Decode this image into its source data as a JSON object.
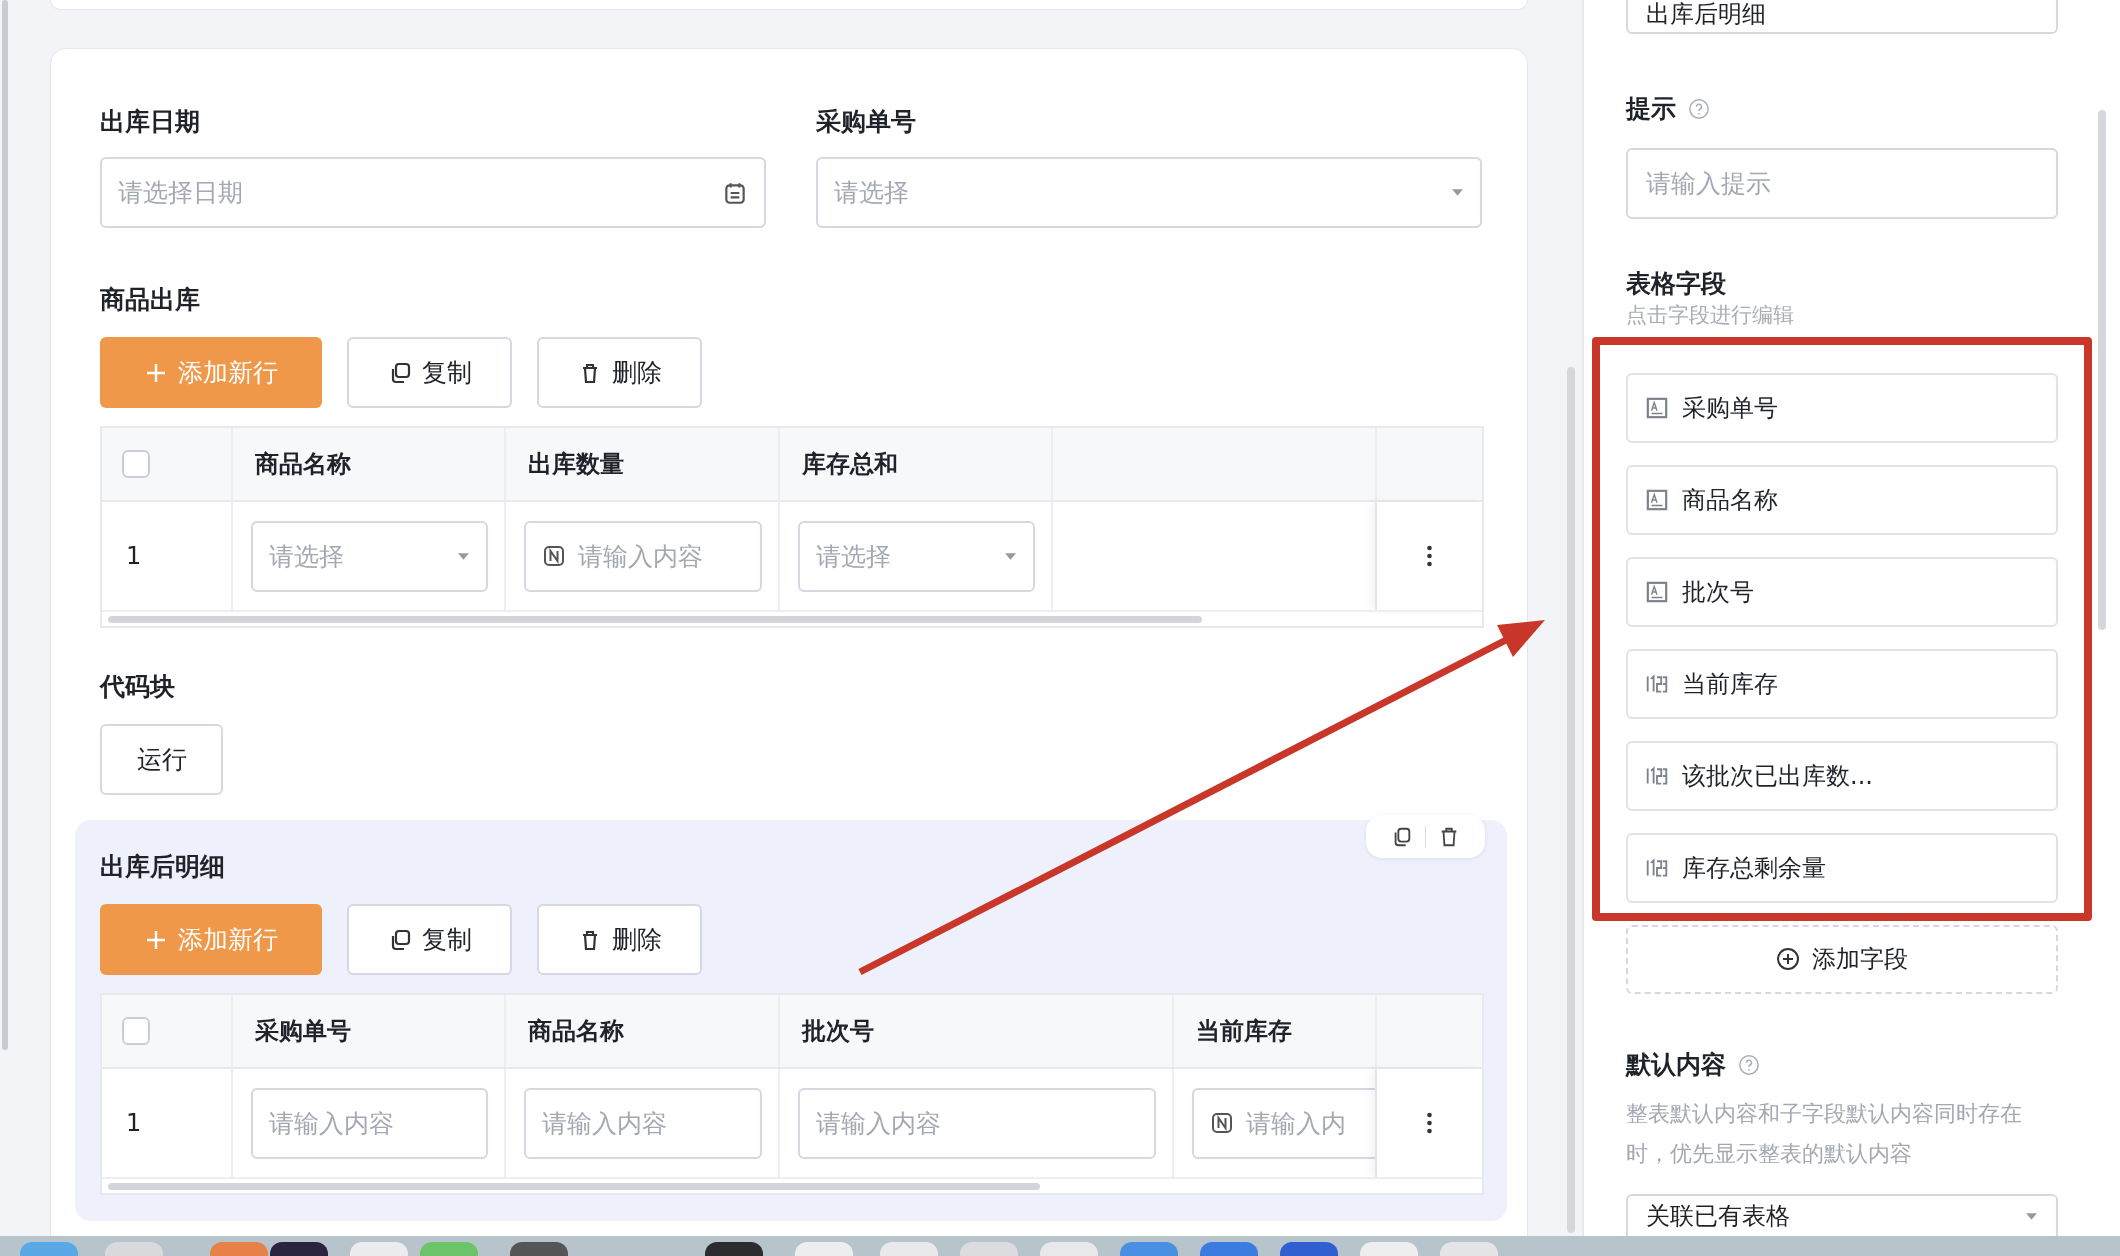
{
  "form": {
    "fields": [
      {
        "label": "出库日期",
        "placeholder": "请选择日期",
        "kind": "date"
      },
      {
        "label": "采购单号",
        "placeholder": "请选择",
        "kind": "select"
      }
    ],
    "sections": [
      {
        "kind": "table",
        "title": "商品出库",
        "selected": false,
        "checked": false,
        "buttons": [
          {
            "label": "添加新行",
            "kind": "primary"
          },
          {
            "label": "复制",
            "kind": "plain"
          },
          {
            "label": "删除",
            "kind": "plain"
          }
        ],
        "columns": [
          "商品名称",
          "出库数量",
          "库存总和"
        ],
        "rows": [
          {
            "index": "1",
            "cells": [
              {
                "kind": "select",
                "placeholder": "请选择"
              },
              {
                "kind": "number",
                "placeholder": "请输入内容"
              },
              {
                "kind": "select",
                "placeholder": "请选择"
              }
            ]
          }
        ]
      },
      {
        "kind": "code",
        "title": "代码块",
        "selected": false,
        "run_label": "运行"
      },
      {
        "kind": "table",
        "title": "出库后明细",
        "selected": true,
        "checked": false,
        "buttons": [
          {
            "label": "添加新行",
            "kind": "primary"
          },
          {
            "label": "复制",
            "kind": "plain"
          },
          {
            "label": "删除",
            "kind": "plain"
          }
        ],
        "columns": [
          "采购单号",
          "商品名称",
          "批次号",
          "当前库存"
        ],
        "rows": [
          {
            "index": "1",
            "cells": [
              {
                "kind": "text",
                "placeholder": "请输入内容"
              },
              {
                "kind": "text",
                "placeholder": "请输入内容"
              },
              {
                "kind": "text",
                "placeholder": "请输入内容"
              },
              {
                "kind": "number",
                "placeholder": "请输入内"
              }
            ]
          }
        ]
      }
    ]
  },
  "panel": {
    "title_field": {
      "value": "出库后明细"
    },
    "hint": {
      "label": "提示",
      "placeholder": "请输入提示"
    },
    "table_fields": {
      "label": "表格字段",
      "hint": "点击字段进行编辑",
      "items": [
        {
          "label": "采购单号",
          "kind": "text"
        },
        {
          "label": "商品名称",
          "kind": "text"
        },
        {
          "label": "批次号",
          "kind": "text"
        },
        {
          "label": "当前库存",
          "kind": "number"
        },
        {
          "label": "该批次已出库数...",
          "kind": "number"
        },
        {
          "label": "库存总剩余量",
          "kind": "number"
        }
      ],
      "add_label": "添加字段"
    },
    "default_content": {
      "label": "默认内容",
      "description": "整表默认内容和子字段默认内容同时存在时，优先显示整表的默认内容",
      "select_value": "关联已有表格"
    }
  }
}
